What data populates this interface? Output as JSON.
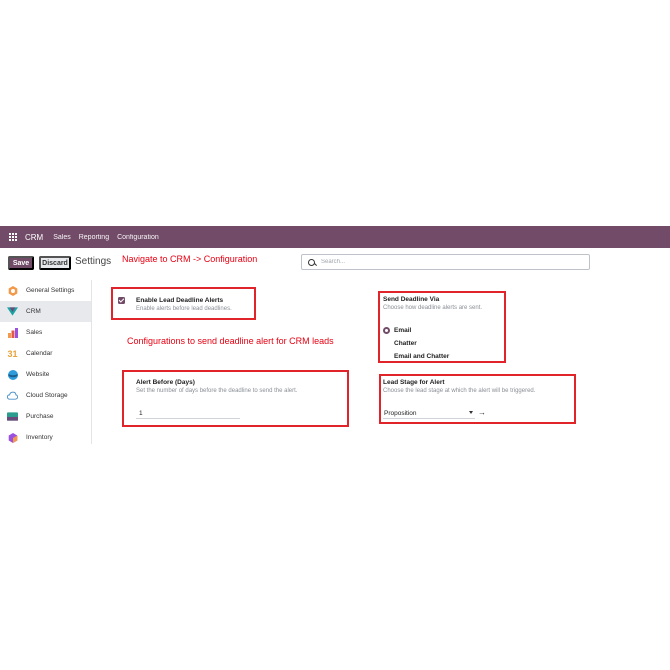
{
  "navbar": {
    "brand": "CRM",
    "menu": [
      "Sales",
      "Reporting",
      "Configuration"
    ]
  },
  "controls": {
    "save_label": "Save",
    "discard_label": "Discard",
    "breadcrumb": "Settings"
  },
  "annotations": {
    "navigate": "Navigate to CRM -> Configuration",
    "configurations": "Configurations to send deadline alert for CRM leads"
  },
  "search": {
    "placeholder": "Search..."
  },
  "sidebar": {
    "items": [
      {
        "label": "General Settings",
        "icon": "general-settings-icon"
      },
      {
        "label": "CRM",
        "icon": "crm-icon"
      },
      {
        "label": "Sales",
        "icon": "sales-icon"
      },
      {
        "label": "Calendar",
        "icon": "calendar-icon",
        "icon_text": "31"
      },
      {
        "label": "Website",
        "icon": "website-icon"
      },
      {
        "label": "Cloud Storage",
        "icon": "cloud-icon"
      },
      {
        "label": "Purchase",
        "icon": "purchase-icon"
      },
      {
        "label": "Inventory",
        "icon": "inventory-icon"
      }
    ]
  },
  "settings": {
    "lead_alerts": {
      "title": "Enable Lead Deadline Alerts",
      "description": "Enable alerts before lead deadlines.",
      "checked": true
    },
    "send_via": {
      "title": "Send Deadline Via",
      "description": "Choose how deadline alerts are sent.",
      "options": [
        "Email",
        "Chatter",
        "Email and Chatter"
      ],
      "selected": "Email"
    },
    "alert_before": {
      "title": "Alert Before (Days)",
      "description": "Set the number of days before the deadline to send the alert.",
      "value": "1"
    },
    "lead_stage": {
      "title": "Lead Stage for Alert",
      "description": "Choose the lead stage at which the alert will be triggered.",
      "value": "Proposition"
    }
  },
  "colors": {
    "brand": "#714b67",
    "highlight": "#e0242a",
    "annotation": "#e60012"
  }
}
